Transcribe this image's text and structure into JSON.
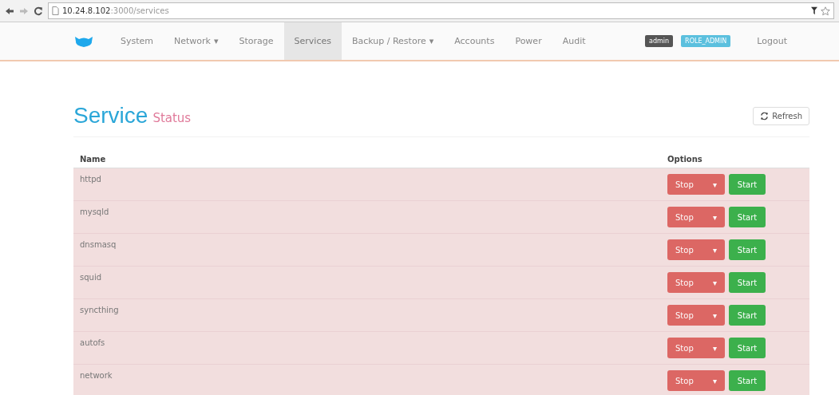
{
  "browser": {
    "url_host": "10.24.8.102",
    "url_path": ":3000/services"
  },
  "navbar": {
    "items": [
      {
        "label": "System",
        "selected": false
      },
      {
        "label": "Network",
        "caret": "▾",
        "selected": false
      },
      {
        "label": "Storage",
        "selected": false
      },
      {
        "label": "Services",
        "selected": true
      },
      {
        "label": "Backup / Restore",
        "caret": "▾",
        "selected": false
      },
      {
        "label": "Accounts",
        "selected": false
      },
      {
        "label": "Power",
        "selected": false
      },
      {
        "label": "Audit",
        "selected": false
      }
    ],
    "user_badge": "admin",
    "role_badge": "ROLE_ADMIN",
    "logout": "Logout"
  },
  "page": {
    "title": "Service",
    "subtitle": "Status",
    "refresh": "Refresh"
  },
  "table": {
    "columns": [
      "Name",
      "Options"
    ],
    "rows": [
      {
        "name": "httpd",
        "running": false,
        "stop": "Stop",
        "caret": "▾",
        "start": "Start"
      },
      {
        "name": "mysqld",
        "running": false,
        "stop": "Stop",
        "caret": "▾",
        "start": "Start"
      },
      {
        "name": "dnsmasq",
        "running": false,
        "stop": "Stop",
        "caret": "▾",
        "start": "Start"
      },
      {
        "name": "squid",
        "running": false,
        "stop": "Stop",
        "caret": "▾",
        "start": "Start"
      },
      {
        "name": "syncthing",
        "running": false,
        "stop": "Stop",
        "caret": "▾",
        "start": "Start"
      },
      {
        "name": "autofs",
        "running": false,
        "stop": "Stop",
        "caret": "▾",
        "start": "Start"
      },
      {
        "name": "network",
        "running": false,
        "stop": "Stop",
        "caret": "▾",
        "start": "Start"
      }
    ]
  }
}
